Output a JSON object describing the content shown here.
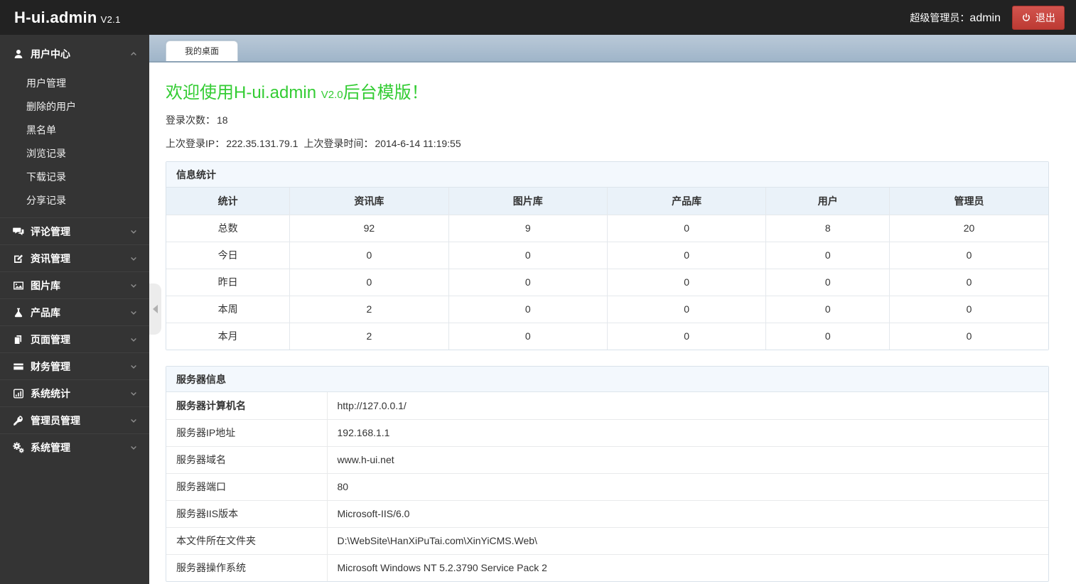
{
  "header": {
    "logo": "H-ui.admin",
    "version": "V2.1",
    "role_label": "超级管理员：",
    "username": "admin",
    "logout_label": "退出",
    "accent_red": "#c9302c"
  },
  "sidebar": {
    "sections": [
      {
        "id": "user-center",
        "icon": "user-icon",
        "label": "用户中心",
        "expanded": true,
        "children": [
          {
            "id": "user-management",
            "label": "用户管理"
          },
          {
            "id": "deleted-users",
            "label": "删除的用户"
          },
          {
            "id": "blacklist",
            "label": "黑名单"
          },
          {
            "id": "browse-history",
            "label": "浏览记录"
          },
          {
            "id": "download-history",
            "label": "下载记录"
          },
          {
            "id": "share-history",
            "label": "分享记录"
          }
        ]
      },
      {
        "id": "comment-management",
        "icon": "comments-icon",
        "label": "评论管理",
        "expanded": false
      },
      {
        "id": "news-management",
        "icon": "edit-icon",
        "label": "资讯管理",
        "expanded": false
      },
      {
        "id": "image-library",
        "icon": "image-icon",
        "label": "图片库",
        "expanded": false
      },
      {
        "id": "product-library",
        "icon": "flask-icon",
        "label": "产品库",
        "expanded": false
      },
      {
        "id": "page-management",
        "icon": "pages-icon",
        "label": "页面管理",
        "expanded": false
      },
      {
        "id": "finance-management",
        "icon": "credit-card-icon",
        "label": "财务管理",
        "expanded": false
      },
      {
        "id": "system-statistics",
        "icon": "bar-chart-icon",
        "label": "系统统计",
        "expanded": false
      },
      {
        "id": "admin-management",
        "icon": "key-icon",
        "label": "管理员管理",
        "expanded": false
      },
      {
        "id": "system-management",
        "icon": "gears-icon",
        "label": "系统管理",
        "expanded": false
      }
    ]
  },
  "tabs": [
    {
      "id": "my-desktop",
      "label": "我的桌面",
      "active": true
    }
  ],
  "welcome": {
    "title_main": "欢迎使用H-ui.admin ",
    "title_version": "V2.0",
    "title_suffix": "后台模版！",
    "title_color": "#33cc33",
    "login_count_label": "登录次数：",
    "login_count": "18",
    "last_ip_label": "上次登录IP：",
    "last_ip": "222.35.131.79.1",
    "last_time_label": "上次登录时间：",
    "last_time": "2014-6-14 11:19:55"
  },
  "stats_panel": {
    "title": "信息统计",
    "columns": [
      "统计",
      "资讯库",
      "图片库",
      "产品库",
      "用户",
      "管理员"
    ],
    "rows": [
      {
        "label": "总数",
        "values": [
          "92",
          "9",
          "0",
          "8",
          "20"
        ]
      },
      {
        "label": "今日",
        "values": [
          "0",
          "0",
          "0",
          "0",
          "0"
        ]
      },
      {
        "label": "昨日",
        "values": [
          "0",
          "0",
          "0",
          "0",
          "0"
        ]
      },
      {
        "label": "本周",
        "values": [
          "2",
          "0",
          "0",
          "0",
          "0"
        ]
      },
      {
        "label": "本月",
        "values": [
          "2",
          "0",
          "0",
          "0",
          "0"
        ]
      }
    ]
  },
  "server_panel": {
    "title": "服务器信息",
    "rows": [
      {
        "label": "服务器计算机名",
        "value": "http://127.0.0.1/",
        "bold": true
      },
      {
        "label": "服务器IP地址",
        "value": "192.168.1.1",
        "bold": false
      },
      {
        "label": "服务器域名",
        "value": "www.h-ui.net",
        "bold": false
      },
      {
        "label": "服务器端口",
        "value": "80",
        "bold": false
      },
      {
        "label": "服务器IIS版本",
        "value": "Microsoft-IIS/6.0",
        "bold": false
      },
      {
        "label": "本文件所在文件夹",
        "value": "D:\\WebSite\\HanXiPuTai.com\\XinYiCMS.Web\\",
        "bold": false
      },
      {
        "label": "服务器操作系统",
        "value": "Microsoft Windows NT 5.2.3790 Service Pack 2",
        "bold": false
      }
    ]
  }
}
